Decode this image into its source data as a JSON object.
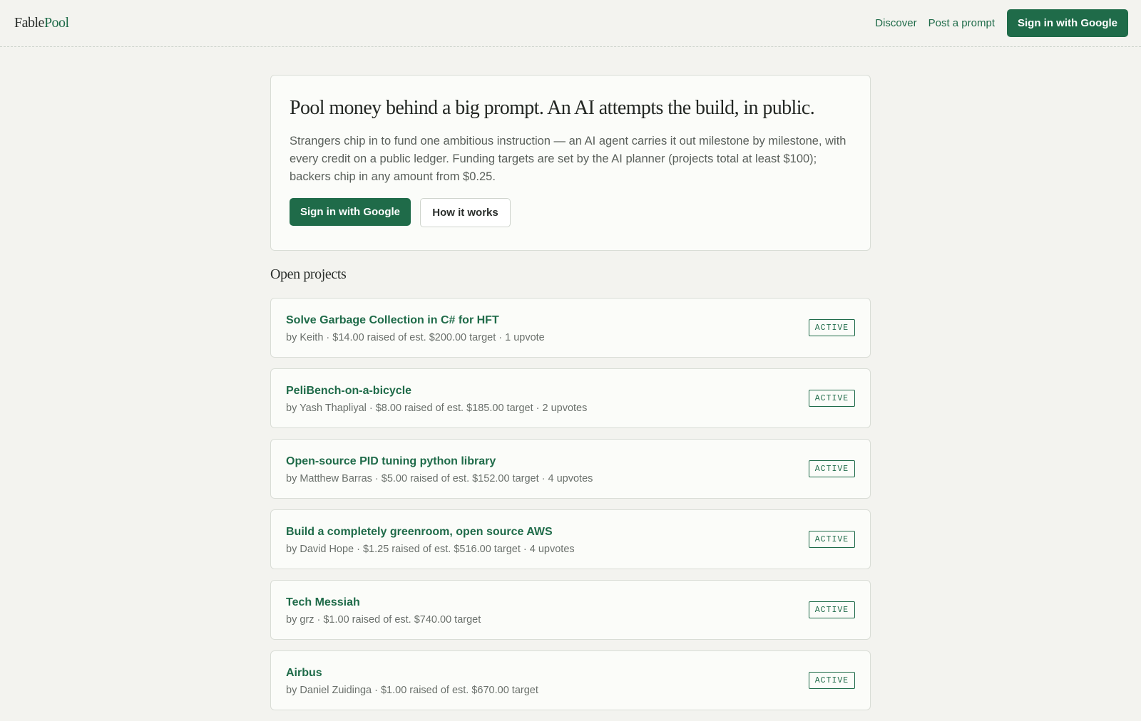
{
  "header": {
    "logo_part1": "Fable",
    "logo_part2": "Pool",
    "nav": {
      "discover": "Discover",
      "post_prompt": "Post a prompt",
      "sign_in": "Sign in with Google"
    }
  },
  "hero": {
    "title": "Pool money behind a big prompt. An AI attempts the build, in public.",
    "description": "Strangers chip in to fund one ambitious instruction — an AI agent carries it out milestone by milestone, with every credit on a public ledger. Funding targets are set by the AI planner (projects total at least $100); backers chip in any amount from $0.25.",
    "primary_button": "Sign in with Google",
    "secondary_button": "How it works"
  },
  "projects_section": {
    "title": "Open projects",
    "items": [
      {
        "title": "Solve Garbage Collection in C# for HFT",
        "meta": "by Keith · $14.00 raised of est. $200.00 target · 1 upvote",
        "status": "ACTIVE"
      },
      {
        "title": "PeliBench-on-a-bicycle",
        "meta": "by Yash Thapliyal · $8.00 raised of est. $185.00 target · 2 upvotes",
        "status": "ACTIVE"
      },
      {
        "title": "Open-source PID tuning python library",
        "meta": "by Matthew Barras · $5.00 raised of est. $152.00 target · 4 upvotes",
        "status": "ACTIVE"
      },
      {
        "title": "Build a completely greenroom, open source AWS",
        "meta": "by David Hope · $1.25 raised of est. $516.00 target · 4 upvotes",
        "status": "ACTIVE"
      },
      {
        "title": "Tech Messiah",
        "meta": "by grz · $1.00 raised of est. $740.00 target",
        "status": "ACTIVE"
      },
      {
        "title": "Airbus",
        "meta": "by Daniel Zuidinga · $1.00 raised of est. $670.00 target",
        "status": "ACTIVE"
      }
    ]
  },
  "colors": {
    "accent": "#1f6b49",
    "background": "#f3f3ef",
    "card": "#fbfcf9"
  }
}
